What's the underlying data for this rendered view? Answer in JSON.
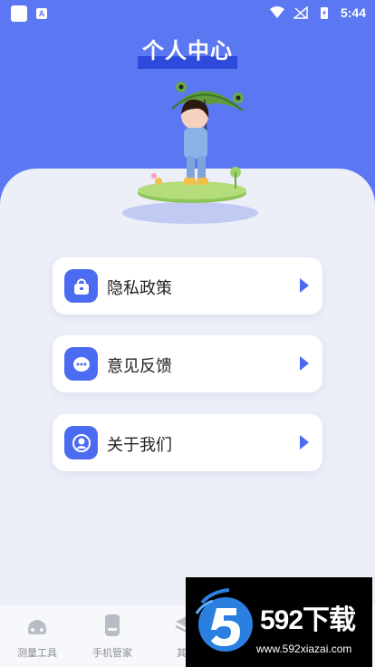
{
  "status_bar": {
    "time": "5:44",
    "notification_letter": "A"
  },
  "header": {
    "title": "个人中心"
  },
  "menu": [
    {
      "label": "隐私政策",
      "icon": "lock-bag-icon"
    },
    {
      "label": "意见反馈",
      "icon": "chat-bubble-icon"
    },
    {
      "label": "关于我们",
      "icon": "user-circle-icon"
    }
  ],
  "tabs": [
    {
      "label": "测量工具",
      "icon": "toolbox-icon"
    },
    {
      "label": "手机管家",
      "icon": "phone-icon"
    },
    {
      "label": "其他",
      "icon": "layers-icon"
    }
  ],
  "watermark": {
    "brand": "592下载",
    "url": "www.592xiazai.com"
  },
  "colors": {
    "primary": "#5b77f2",
    "accent": "#4b6cf0",
    "background": "#eceff8"
  }
}
